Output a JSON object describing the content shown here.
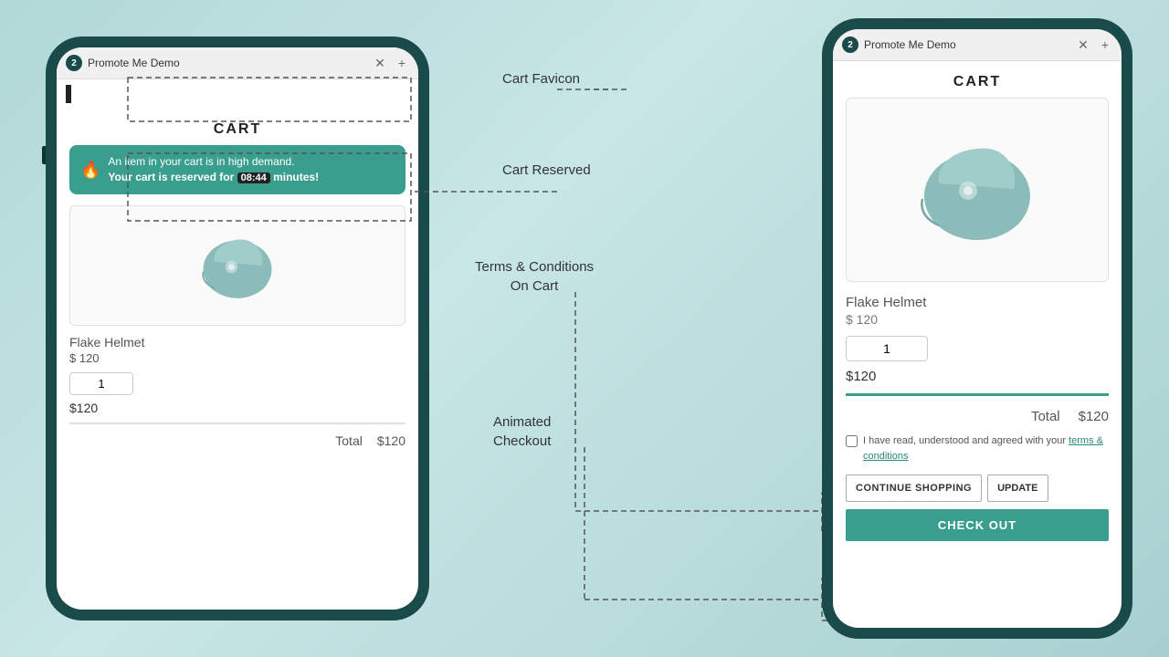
{
  "scene": {
    "background": "#b8d8d8"
  },
  "annotations": {
    "cart_favicon": "Cart Favicon",
    "cart_reserved": "Cart Reserved",
    "terms_conditions": "Terms & Conditions\nOn Cart",
    "animated_checkout": "Animated\nCheckout"
  },
  "left_phone": {
    "tab_badge": "2",
    "tab_title": "Promote Me Demo",
    "cart_title": "CART",
    "demand_banner": {
      "text_line1": "An item in your cart is in high demand.",
      "text_line2": "Your cart is reserved for",
      "timer": "08:44",
      "text_suffix": "minutes!"
    },
    "product": {
      "name": "Flake Helmet",
      "price": "$ 120",
      "qty": "1",
      "subtotal": "$120",
      "total_label": "Total",
      "total_value": "$120"
    }
  },
  "right_phone": {
    "tab_badge": "2",
    "tab_title": "Promote Me Demo",
    "cart_title": "CART",
    "product": {
      "name": "Flake Helmet",
      "price": "$ 120",
      "qty": "1",
      "subtotal": "$120",
      "total_label": "Total",
      "total_value": "$120"
    },
    "terms": {
      "prefix": "I have read, understood and agreed with your",
      "link": "terms & conditions"
    },
    "buttons": {
      "continue": "CONTINUE SHOPPING",
      "update": "UPDATE",
      "checkout": "CHECK OUT"
    }
  }
}
